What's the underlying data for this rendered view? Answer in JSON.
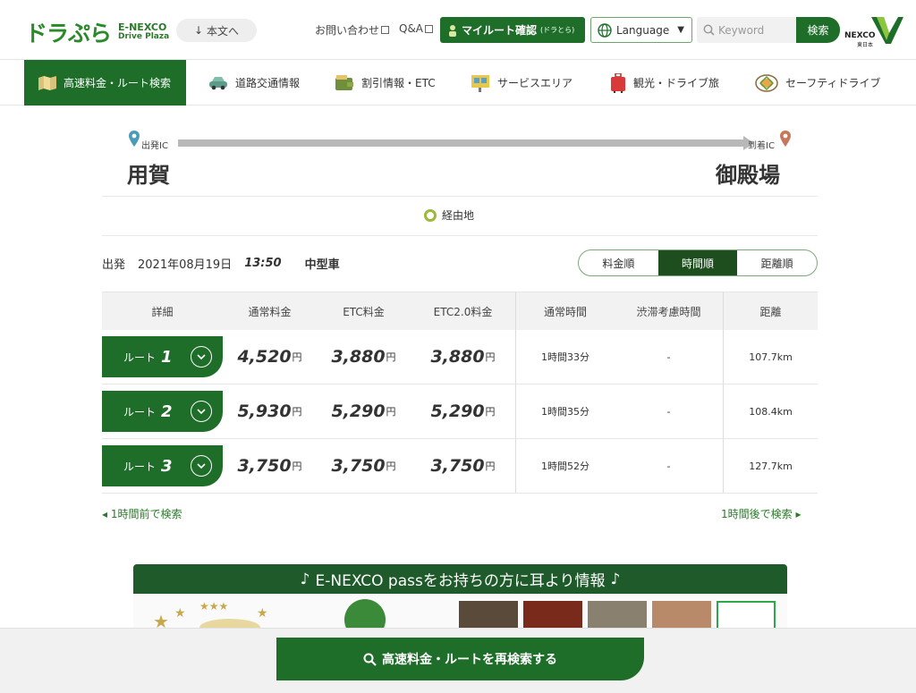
{
  "header": {
    "logo_main": "ドラぷら",
    "logo_sub1": "E-NEXCO",
    "logo_sub2": "Drive Plaza",
    "skip_label": "本文へ",
    "contact_label": "お問い合わせ",
    "qa_label": "Q&A",
    "myroute_label": "マイルート確認",
    "myroute_small": "(ドラとら)",
    "language_label": "Language",
    "search_placeholder": "Keyword",
    "search_button": "検索",
    "nexco_label": "NEXCO",
    "nexco_sub": "東日本"
  },
  "nav": {
    "items": [
      {
        "label": "高速料金・ルート検索",
        "icon": "map-icon"
      },
      {
        "label": "道路交通情報",
        "icon": "car-icon"
      },
      {
        "label": "割引情報・ETC",
        "icon": "wallet-icon"
      },
      {
        "label": "サービスエリア",
        "icon": "service-area-icon"
      },
      {
        "label": "観光・ドライブ旅",
        "icon": "suitcase-icon"
      },
      {
        "label": "セーフティドライブ",
        "icon": "safety-icon"
      }
    ]
  },
  "route": {
    "origin_label": "出発IC",
    "origin": "用賀",
    "dest_label": "到着IC",
    "dest": "御殿場",
    "via_label": "経由地"
  },
  "search_info": {
    "depart_label": "出発",
    "date": "2021年08月19日",
    "time": "13:50",
    "vehicle": "中型車"
  },
  "sort": {
    "options": [
      "料金順",
      "時間順",
      "距離順"
    ],
    "selected": "時間順"
  },
  "table": {
    "headers": [
      "詳細",
      "通常料金",
      "ETC料金",
      "ETC2.0料金",
      "通常時間",
      "渋滞考慮時間",
      "距離"
    ],
    "yen": "円",
    "rows": [
      {
        "route_label": "ルート",
        "route_num": "1",
        "normal": "4,520",
        "etc": "3,880",
        "etc2": "3,880",
        "time": "1時間33分",
        "jam_time": "-",
        "distance": "107.7km"
      },
      {
        "route_label": "ルート",
        "route_num": "2",
        "normal": "5,930",
        "etc": "5,290",
        "etc2": "5,290",
        "time": "1時間35分",
        "jam_time": "-",
        "distance": "108.4km"
      },
      {
        "route_label": "ルート",
        "route_num": "3",
        "normal": "3,750",
        "etc": "3,750",
        "etc2": "3,750",
        "time": "1時間52分",
        "jam_time": "-",
        "distance": "127.7km"
      }
    ]
  },
  "pager": {
    "prev": "◂ 1時間前で検索",
    "next": "1時間後で検索 ▸"
  },
  "banner": {
    "title": "E-NEXCO passをお持ちの方に耳より情報"
  },
  "bottom": {
    "research_label": "高速料金・ルートを再検索する"
  },
  "colors": {
    "brand_green": "#1e6e2a",
    "dark_green": "#1e4e1e",
    "via_dot": "#9cb93a"
  }
}
